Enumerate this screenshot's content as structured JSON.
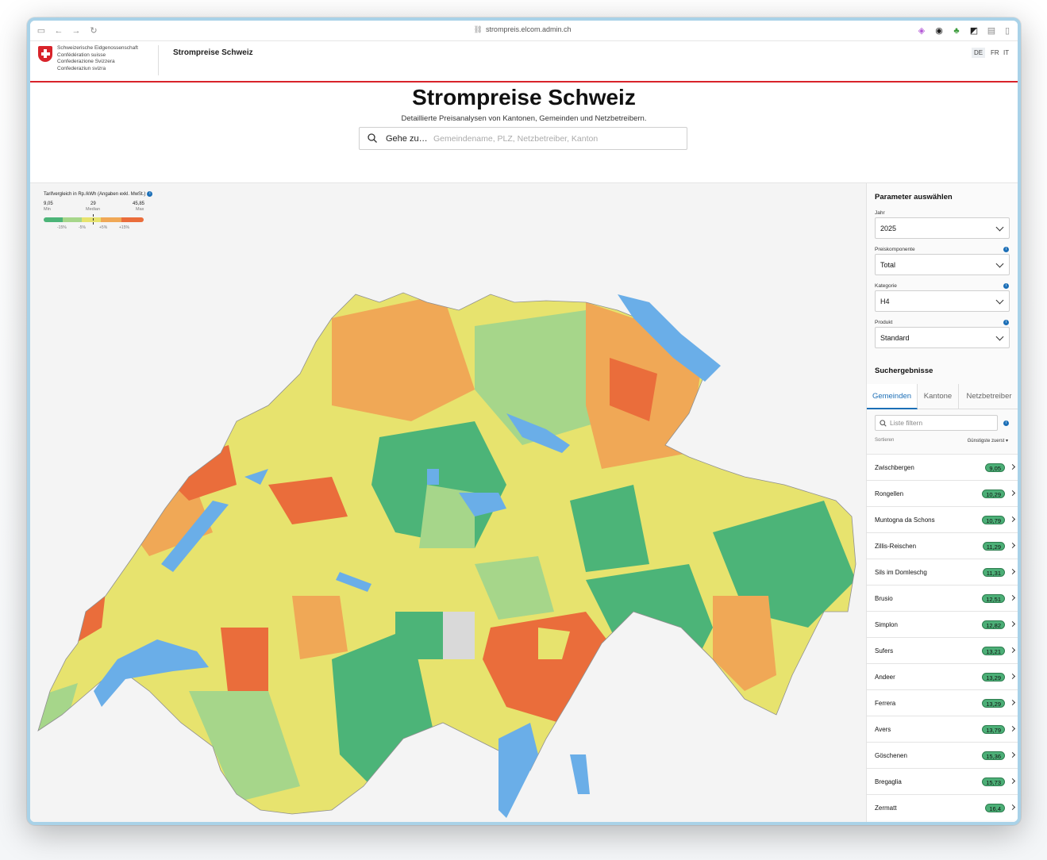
{
  "browser": {
    "url": "strompreis.elcom.admin.ch"
  },
  "header": {
    "confederation": [
      "Schweizerische Eidgenossenschaft",
      "Confédération suisse",
      "Confederazione Svizzera",
      "Confederaziun svizra"
    ],
    "site_title": "Strompreise Schweiz",
    "languages": [
      "DE",
      "FR",
      "IT"
    ],
    "active_language": "DE"
  },
  "hero": {
    "title": "Strompreise Schweiz",
    "subtitle": "Detaillierte Preisanalysen von Kantonen, Gemeinden und Netzbetreibern.",
    "search_label": "Gehe zu…",
    "search_placeholder": "Gemeindename, PLZ, Netzbetreiber, Kanton"
  },
  "legend": {
    "title": "Tarifvergleich in Rp./kWh (Angaben exkl. MwSt.)",
    "min_value": "9,05",
    "min_label": "Min",
    "median_value": "29",
    "median_label": "Median",
    "max_value": "45,85",
    "max_label": "Max",
    "ticks": [
      "-15%",
      "-5%",
      "+5%",
      "+15%"
    ],
    "colors": [
      "#4cb478",
      "#a6d68a",
      "#e7e36e",
      "#f0a856",
      "#ea6d3b"
    ]
  },
  "panel": {
    "params_title": "Parameter auswählen",
    "fields": [
      {
        "label": "Jahr",
        "value": "2025",
        "info": false
      },
      {
        "label": "Preiskomponente",
        "value": "Total",
        "info": true
      },
      {
        "label": "Kategorie",
        "value": "H4",
        "info": true
      },
      {
        "label": "Produkt",
        "value": "Standard",
        "info": true
      }
    ],
    "results_title": "Suchergebnisse",
    "tabs": [
      "Gemeinden",
      "Kantone",
      "Netzbetreiber"
    ],
    "active_tab": "Gemeinden",
    "filter_placeholder": "Liste filtern",
    "sort_label": "Sortieren",
    "sort_value": "Günstigste zuerst",
    "results": [
      {
        "name": "Zwischbergen",
        "price": "9,05"
      },
      {
        "name": "Rongellen",
        "price": "10,29"
      },
      {
        "name": "Muntogna da Schons",
        "price": "10,79"
      },
      {
        "name": "Zillis-Reischen",
        "price": "11,29"
      },
      {
        "name": "Sils im Domleschg",
        "price": "11,31"
      },
      {
        "name": "Brusio",
        "price": "12,51"
      },
      {
        "name": "Simplon",
        "price": "12,82"
      },
      {
        "name": "Sufers",
        "price": "13,21"
      },
      {
        "name": "Andeer",
        "price": "13,29"
      },
      {
        "name": "Ferrera",
        "price": "13,29"
      },
      {
        "name": "Avers",
        "price": "13,79"
      },
      {
        "name": "Göschenen",
        "price": "15,36"
      },
      {
        "name": "Bregaglia",
        "price": "15,73"
      },
      {
        "name": "Zermatt",
        "price": "16,4"
      }
    ]
  },
  "map": {
    "lake_color": "#6aaee8",
    "no_data_color": "#d9d9d9"
  }
}
